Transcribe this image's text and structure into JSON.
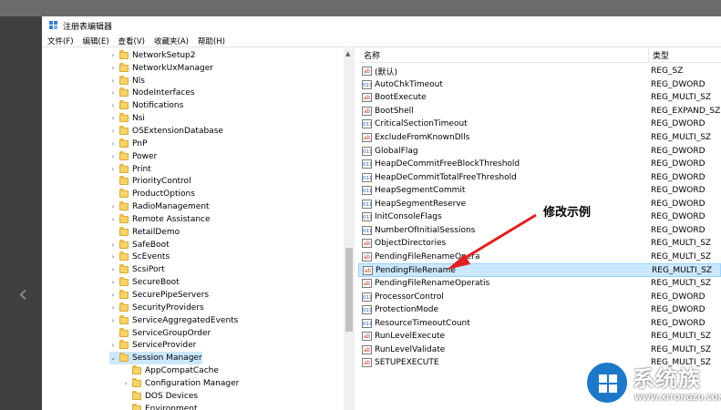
{
  "window": {
    "title": "注册表编辑器"
  },
  "menu": [
    "文件(F)",
    "编辑(E)",
    "查看(V)",
    "收藏夹(A)",
    "帮助(H)"
  ],
  "tree": {
    "items": [
      {
        "label": "NetworkSetup2",
        "exp": "›"
      },
      {
        "label": "NetworkUxManager",
        "exp": "›"
      },
      {
        "label": "Nls",
        "exp": "›"
      },
      {
        "label": "NodeInterfaces",
        "exp": "›"
      },
      {
        "label": "Notifications",
        "exp": "›"
      },
      {
        "label": "Nsi",
        "exp": "›"
      },
      {
        "label": "OSExtensionDatabase",
        "exp": "›"
      },
      {
        "label": "PnP",
        "exp": "›"
      },
      {
        "label": "Power",
        "exp": "›"
      },
      {
        "label": "Print",
        "exp": "›"
      },
      {
        "label": "PriorityControl",
        "exp": ""
      },
      {
        "label": "ProductOptions",
        "exp": ""
      },
      {
        "label": "RadioManagement",
        "exp": "›"
      },
      {
        "label": "Remote Assistance",
        "exp": "›"
      },
      {
        "label": "RetailDemo",
        "exp": ""
      },
      {
        "label": "SafeBoot",
        "exp": "›"
      },
      {
        "label": "ScEvents",
        "exp": "›"
      },
      {
        "label": "ScsiPort",
        "exp": "›"
      },
      {
        "label": "SecureBoot",
        "exp": "›"
      },
      {
        "label": "SecurePipeServers",
        "exp": "›"
      },
      {
        "label": "SecurityProviders",
        "exp": "›"
      },
      {
        "label": "ServiceAggregatedEvents",
        "exp": "›"
      },
      {
        "label": "ServiceGroupOrder",
        "exp": ""
      },
      {
        "label": "ServiceProvider",
        "exp": "›"
      },
      {
        "label": "Session Manager",
        "exp": "⌄",
        "selected": true
      },
      {
        "label": "AppCompatCache",
        "exp": "",
        "child": true
      },
      {
        "label": "Configuration Manager",
        "exp": "›",
        "child": true
      },
      {
        "label": "DOS Devices",
        "exp": "",
        "child": true
      },
      {
        "label": "Environment",
        "exp": "",
        "child": true
      }
    ]
  },
  "list": {
    "header": {
      "name": "名称",
      "type": "类型"
    },
    "rows": [
      {
        "name": "(默认)",
        "type": "REG_SZ",
        "icon": "sz"
      },
      {
        "name": "AutoChkTimeout",
        "type": "REG_DWORD",
        "icon": "bin"
      },
      {
        "name": "BootExecute",
        "type": "REG_MULTI_SZ",
        "icon": "sz"
      },
      {
        "name": "BootShell",
        "type": "REG_EXPAND_SZ",
        "icon": "sz"
      },
      {
        "name": "CriticalSectionTimeout",
        "type": "REG_DWORD",
        "icon": "bin"
      },
      {
        "name": "ExcludeFromKnownDlls",
        "type": "REG_MULTI_SZ",
        "icon": "sz"
      },
      {
        "name": "GlobalFlag",
        "type": "REG_DWORD",
        "icon": "bin"
      },
      {
        "name": "HeapDeCommitFreeBlockThreshold",
        "type": "REG_DWORD",
        "icon": "bin"
      },
      {
        "name": "HeapDeCommitTotalFreeThreshold",
        "type": "REG_DWORD",
        "icon": "bin"
      },
      {
        "name": "HeapSegmentCommit",
        "type": "REG_DWORD",
        "icon": "bin"
      },
      {
        "name": "HeapSegmentReserve",
        "type": "REG_DWORD",
        "icon": "bin"
      },
      {
        "name": "InitConsoleFlags",
        "type": "REG_DWORD",
        "icon": "bin"
      },
      {
        "name": "NumberOfInitialSessions",
        "type": "REG_DWORD",
        "icon": "bin"
      },
      {
        "name": "ObjectDirectories",
        "type": "REG_MULTI_SZ",
        "icon": "sz"
      },
      {
        "name": "PendingFileRenameOpera",
        "type": "REG_MULTI_SZ",
        "icon": "sz"
      },
      {
        "name": "PendingFileRename",
        "type": "REG_MULTI_SZ",
        "icon": "sz",
        "selected": true
      },
      {
        "name": "PendingFileRenameOperatis",
        "type": "REG_MULTI_SZ",
        "icon": "sz"
      },
      {
        "name": "ProcessorControl",
        "type": "REG_DWORD",
        "icon": "bin"
      },
      {
        "name": "ProtectionMode",
        "type": "REG_DWORD",
        "icon": "bin"
      },
      {
        "name": "ResourceTimeoutCount",
        "type": "REG_DWORD",
        "icon": "bin"
      },
      {
        "name": "RunLevelExecute",
        "type": "REG_MULTI_SZ",
        "icon": "sz"
      },
      {
        "name": "RunLevelValidate",
        "type": "REG_MULTI_SZ",
        "icon": "sz"
      },
      {
        "name": "SETUPEXECUTE",
        "type": "REG_MULTI_SZ",
        "icon": "sz"
      }
    ]
  },
  "annotation": {
    "text": "修改示例",
    "color": "#e02020"
  },
  "watermark": {
    "brand": "系统族",
    "url": "WWW.XITONGZU.COM"
  },
  "icons": {
    "sz": "ab",
    "bin": "011"
  }
}
